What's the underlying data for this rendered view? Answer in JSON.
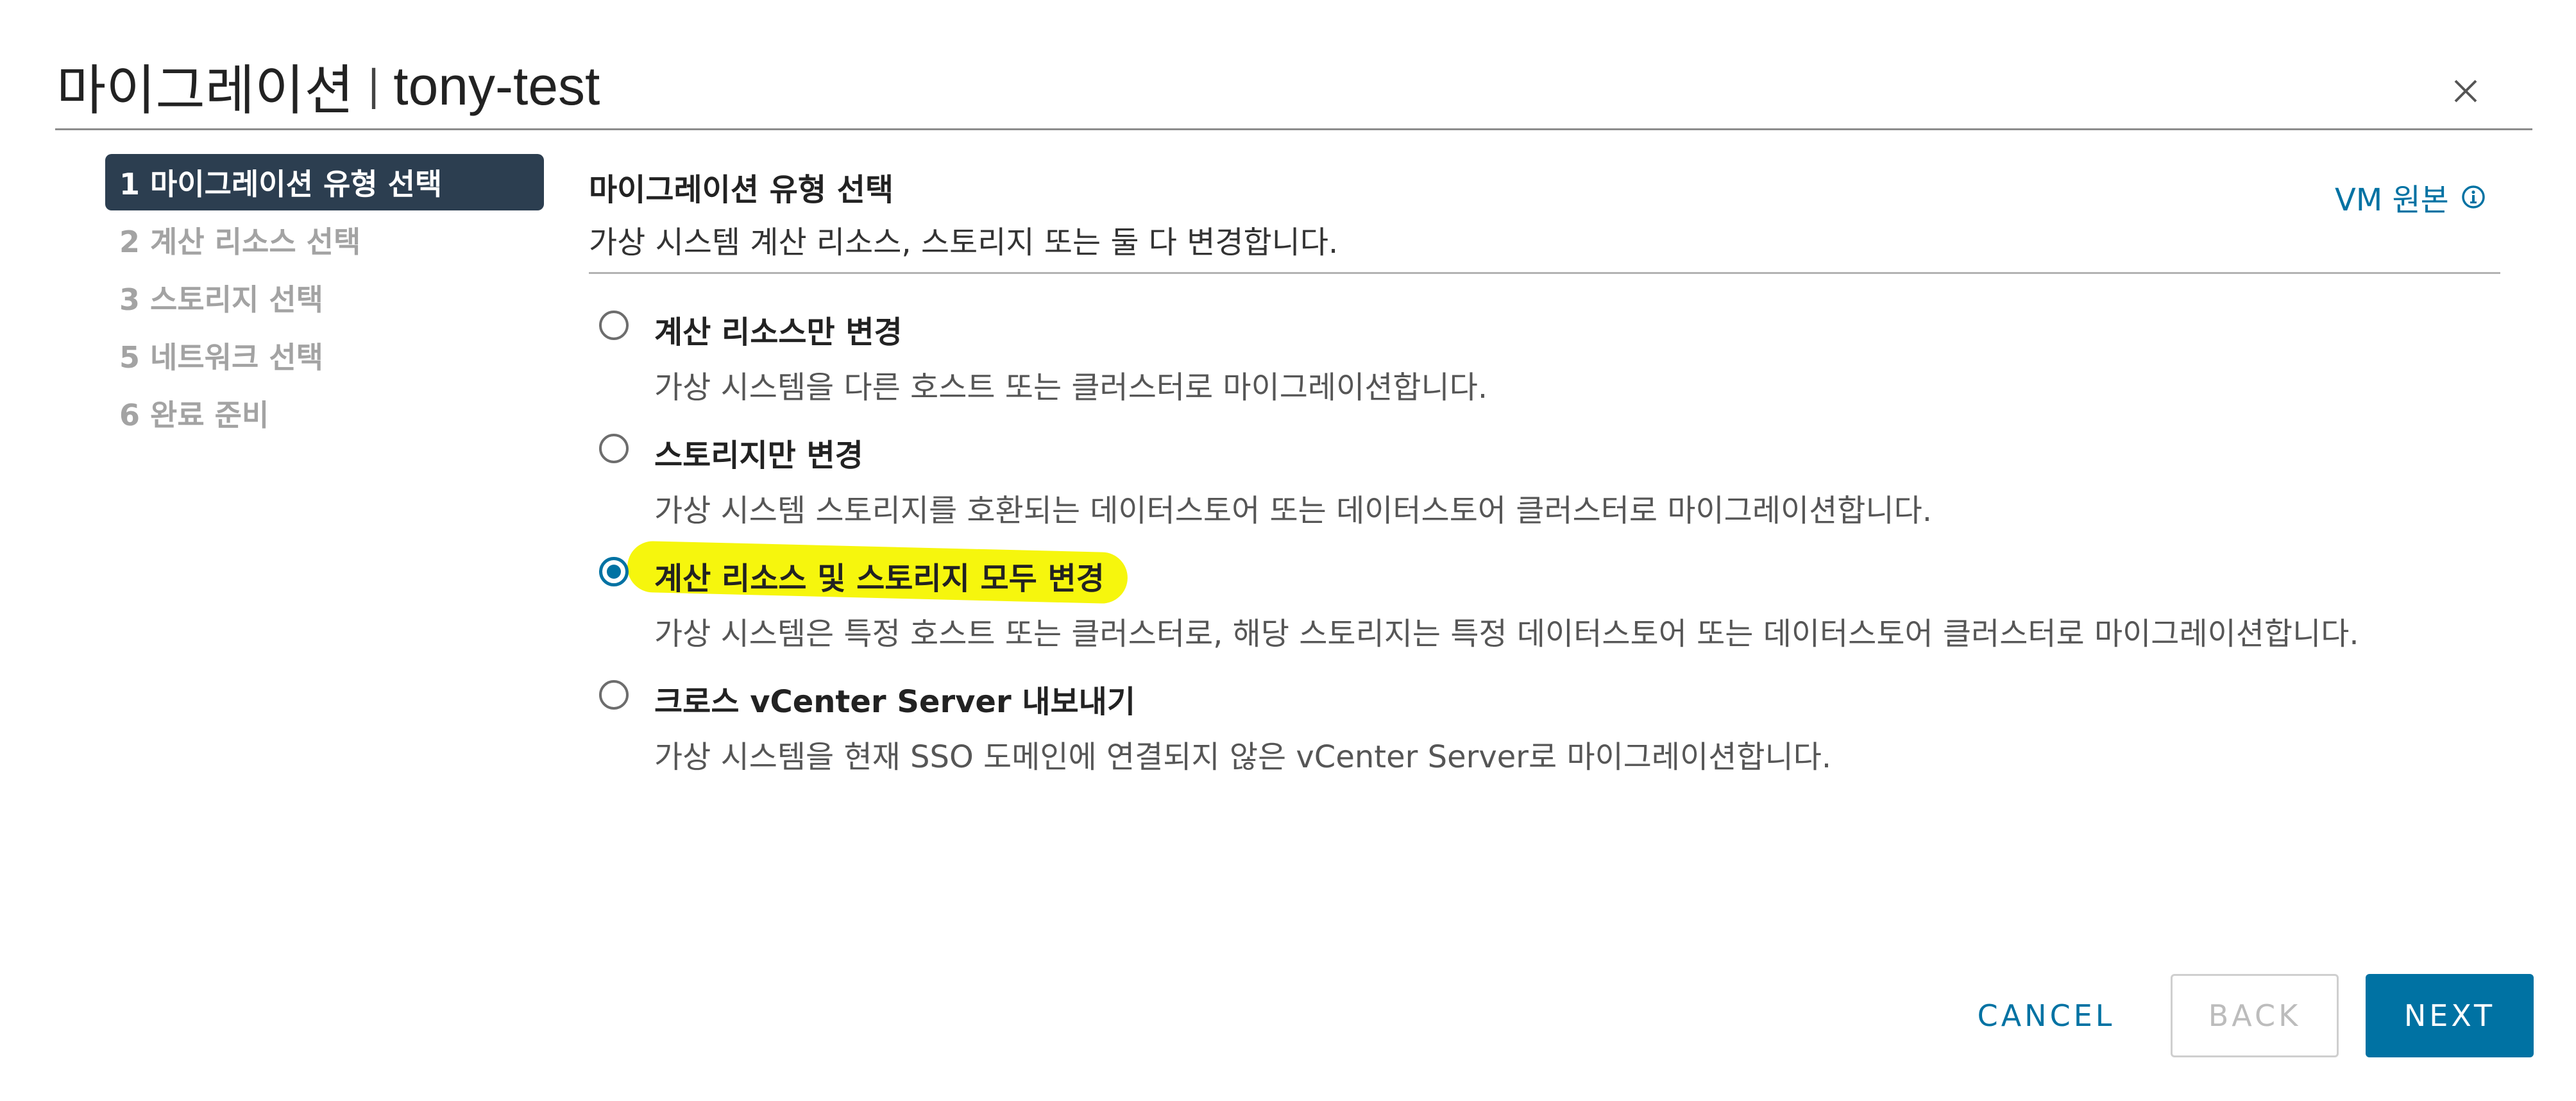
{
  "dialog": {
    "title": "마이그레이션",
    "separator": "|",
    "vm_name": "tony-test",
    "close_icon": "close-icon"
  },
  "nav": {
    "steps": [
      {
        "label": "1 마이그레이션 유형 선택",
        "active": true
      },
      {
        "label": "2 계산 리소스 선택",
        "active": false
      },
      {
        "label": "3 스토리지 선택",
        "active": false
      },
      {
        "label": "5 네트워크 선택",
        "active": false
      },
      {
        "label": "6 완료 준비",
        "active": false
      }
    ]
  },
  "content": {
    "section_title": "마이그레이션 유형 선택",
    "section_desc": "가상 시스템 계산 리소스, 스토리지 또는 둘 다 변경합니다.",
    "vm_origin_label": "VM 원본",
    "vm_origin_icon": "info-icon"
  },
  "options": [
    {
      "label": "계산 리소스만 변경",
      "desc": "가상 시스템을 다른 호스트 또는 클러스터로 마이그레이션합니다.",
      "checked": false
    },
    {
      "label": "스토리지만 변경",
      "desc": "가상 시스템 스토리지를 호환되는 데이터스토어 또는 데이터스토어 클러스터로 마이그레이션합니다.",
      "checked": false
    },
    {
      "label": "계산 리소스 및 스토리지 모두 변경",
      "desc": "가상 시스템은 특정 호스트 또는 클러스터로, 해당 스토리지는 특정 데이터스토어 또는 데이터스토어 클러스터로 마이그레이션합니다.",
      "checked": true
    },
    {
      "label": "크로스 vCenter Server 내보내기",
      "desc": "가상 시스템을 현재 SSO 도메인에 연결되지 않은 vCenter Server로 마이그레이션합니다.",
      "checked": false
    }
  ],
  "buttons": {
    "cancel": "CANCEL",
    "back": "BACK",
    "next": "NEXT"
  },
  "colors": {
    "accent": "#0072a3",
    "nav_active_bg": "#2c3e50",
    "highlight": "#f6f600"
  }
}
